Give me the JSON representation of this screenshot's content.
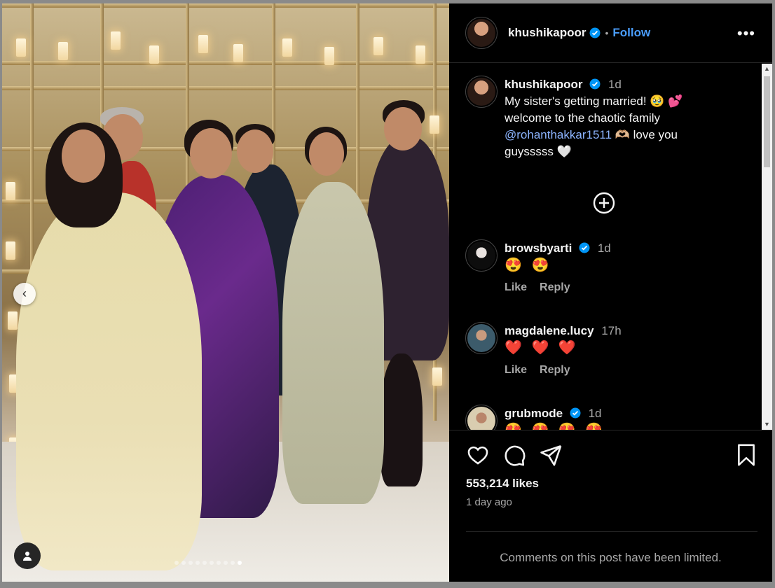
{
  "post": {
    "author": "khushikapoor",
    "separator": "•",
    "follow_label": "Follow",
    "more_label": "•••"
  },
  "caption": {
    "author": "khushikapoor",
    "time": "1d",
    "line1": "My sister's getting married! 🥹 💕",
    "line2": "welcome to the chaotic family",
    "mention": "@rohanthakkar1511",
    "line3": " 🫶🏼 love you",
    "line4": "guysssss 🤍"
  },
  "comments": [
    {
      "user": "browsbyarti",
      "verified": true,
      "time": "1d",
      "text": "😍 😍",
      "like": "Like",
      "reply": "Reply"
    },
    {
      "user": "magdalene.lucy",
      "verified": false,
      "time": "17h",
      "text": "❤️ ❤️ ❤️",
      "like": "Like",
      "reply": "Reply"
    },
    {
      "user": "grubmode",
      "verified": true,
      "time": "1d",
      "text": "😍 😍 😍 😍"
    }
  ],
  "stats": {
    "likes": "553,214 likes",
    "date": "1 day ago"
  },
  "footer": {
    "limited": "Comments on this post have been limited."
  },
  "carousel": {
    "total": 10,
    "active_index": 9
  },
  "icons": [
    "more-icon",
    "verified-icon",
    "plus-circle-icon",
    "heart-icon",
    "comment-icon",
    "share-icon",
    "bookmark-icon",
    "chevron-left-icon",
    "user-tag-icon"
  ],
  "colors": {
    "background": "#000000",
    "accent": "#0095f6",
    "muted": "#a8a8a8"
  }
}
